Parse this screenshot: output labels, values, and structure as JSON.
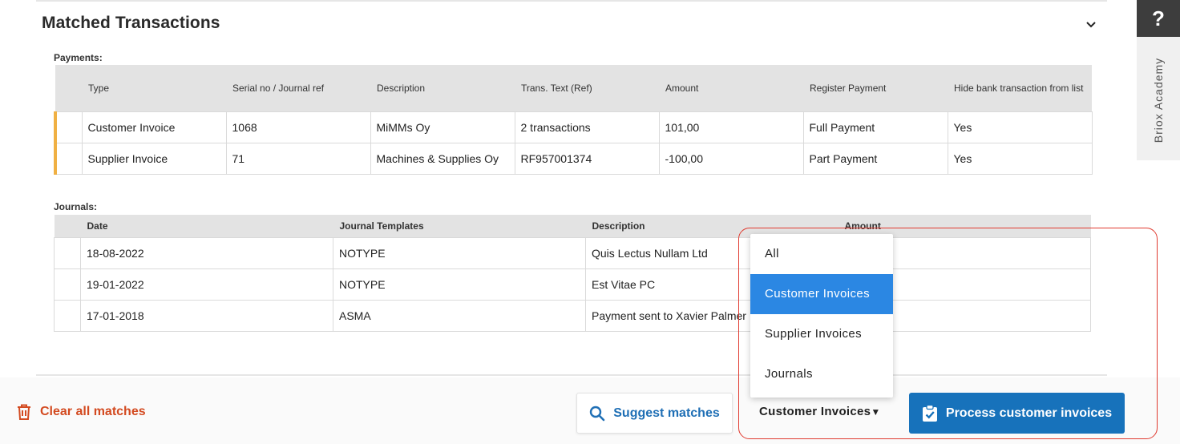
{
  "section": {
    "title": "Matched Transactions"
  },
  "payments": {
    "label": "Payments:",
    "columns": [
      "Type",
      "Serial no / Journal ref",
      "Description",
      "Trans. Text (Ref)",
      "Amount",
      "Register Payment",
      "Hide bank transaction from list"
    ],
    "rows": [
      [
        "Customer Invoice",
        "1068",
        "MiMMs Oy",
        "2 transactions",
        "101,00",
        "Full Payment",
        "Yes"
      ],
      [
        "Supplier Invoice",
        "71",
        "Machines & Supplies Oy",
        "RF957001374",
        "-100,00",
        "Part Payment",
        "Yes"
      ]
    ]
  },
  "journals": {
    "label": "Journals:",
    "columns": [
      "Date",
      "Journal Templates",
      "Description",
      "Amount"
    ],
    "rows": [
      [
        "18-08-2022",
        "NOTYPE",
        "Quis Lectus Nullam Ltd",
        ""
      ],
      [
        "19-01-2022",
        "NOTYPE",
        "Est Vitae PC",
        ""
      ],
      [
        "17-01-2018",
        "ASMA",
        "Payment sent to Xavier Palmer",
        ""
      ]
    ]
  },
  "dropdown": {
    "options": [
      "All",
      "Customer Invoices",
      "Supplier Invoices",
      "Journals"
    ],
    "selected_index": 1
  },
  "footer": {
    "clear_label": "Clear all matches",
    "suggest_label": "Suggest matches",
    "filter_value": "Customer Invoices",
    "filter_arrow": "▼",
    "process_label": "Process customer invoices"
  },
  "sidebar": {
    "help_glyph": "?",
    "academy_label": "Briox Academy"
  },
  "icons": {
    "collapse": "chevron-down-icon",
    "clear": "trash-icon",
    "suggest": "search-icon",
    "process": "clipboard-check-icon"
  },
  "colors": {
    "accent_row": "#f0b043",
    "primary": "#1772bb",
    "danger": "#d34a20",
    "dropdown_selected": "#2b87e3",
    "highlight_outline": "#e03a2f"
  }
}
